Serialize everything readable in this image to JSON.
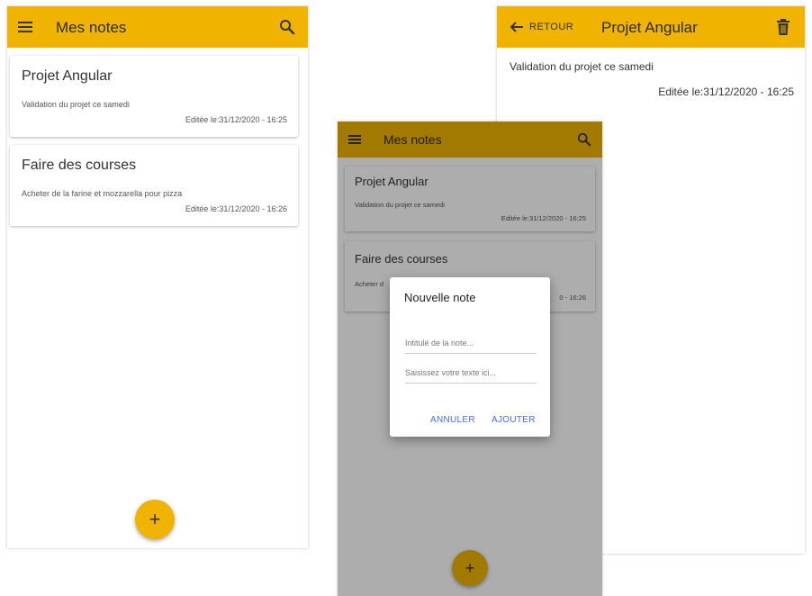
{
  "list_screen": {
    "app_title": "Mes notes",
    "menu_icon": "menu-icon",
    "search_icon": "search-icon",
    "notes": [
      {
        "title": "Projet Angular",
        "body": "Validation du projet ce samedi",
        "date": "Editée le:31/12/2020 - 16:25"
      },
      {
        "title": "Faire des courses",
        "body": "Acheter de la farine et mozzarella pour pizza",
        "date": "Editée le:31/12/2020 - 16:26"
      }
    ],
    "fab_label": "+"
  },
  "detail_screen": {
    "back_label": "RETOUR",
    "back_icon": "arrow-left-icon",
    "title": "Projet Angular",
    "delete_icon": "trash-icon",
    "body": "Validation du projet ce samedi",
    "date": "Editée le:31/12/2020 - 16:25"
  },
  "dialog_screen": {
    "app_title": "Mes notes",
    "notes": [
      {
        "title": "Projet Angular",
        "body": "Validation du projet ce samedi",
        "date": "Editée le:31/12/2020 - 16:25"
      },
      {
        "title": "Faire des courses",
        "body": "Acheter d",
        "date": "0 - 16:26"
      }
    ],
    "fab_label": "+",
    "dialog": {
      "title": "Nouvelle note",
      "title_placeholder": "Intitulé de la note...",
      "text_placeholder": "Saisissez votre texte ici...",
      "cancel_label": "ANNULER",
      "confirm_label": "AJOUTER"
    }
  },
  "colors": {
    "accent": "#f0b400",
    "dialog_button": "#4a6fdc"
  }
}
